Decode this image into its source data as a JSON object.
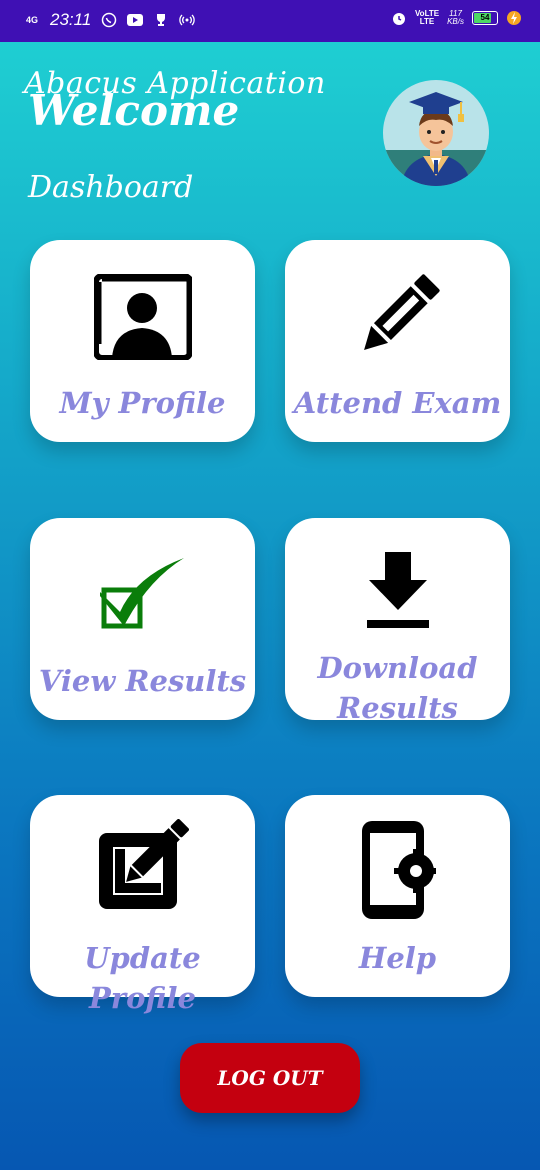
{
  "status_bar": {
    "network": "4G",
    "time": "23:11",
    "speed_value": "117",
    "speed_unit": "KB/s",
    "lte": "LTE",
    "volte": "VoLTE",
    "battery": "54",
    "icons": [
      "whatsapp-icon",
      "youtube-icon",
      "trophy-icon",
      "hotspot-icon",
      "alarm-icon",
      "charging-icon"
    ]
  },
  "header": {
    "app_title": "Abacus Application",
    "welcome": "Welcome",
    "subtitle": "Dashboard"
  },
  "tiles": [
    {
      "label": "My Profile",
      "icon": "profile-card-icon"
    },
    {
      "label": "Attend Exam",
      "icon": "pencil-icon"
    },
    {
      "label": "View Results",
      "icon": "checkmark-box-icon"
    },
    {
      "label_line1": "Download",
      "label_line2": "Results",
      "icon": "download-icon"
    },
    {
      "label": "Update Profile",
      "icon": "edit-icon"
    },
    {
      "label": "Help",
      "icon": "phone-settings-icon"
    }
  ],
  "logout": {
    "label": "LOG OUT"
  },
  "colors": {
    "statusbar": "#3f10b4",
    "tile_label": "#8a87dc",
    "logout": "#c4000f",
    "check": "#0a7d0a"
  }
}
